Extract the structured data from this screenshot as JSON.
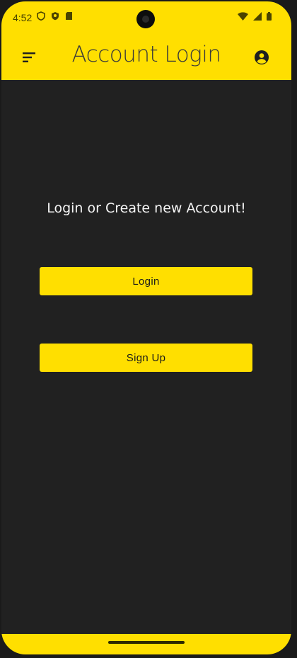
{
  "status_bar": {
    "time": "4:52",
    "left_icons": [
      "shield-outline-icon",
      "shield-filled-icon",
      "sim-card-icon"
    ],
    "right_icons": [
      "wifi-icon",
      "cell-signal-icon",
      "battery-icon"
    ]
  },
  "app_bar": {
    "title": "Account Login",
    "menu_icon": "sort-menu-icon",
    "account_icon": "account-circle-icon"
  },
  "main": {
    "prompt": "Login or Create new Account!",
    "login_button": "Login",
    "signup_button": "Sign Up"
  },
  "colors": {
    "accent": "#ffdf00",
    "background": "#212121",
    "text_on_dark": "#f5f5f5",
    "text_on_accent": "#1a1a1a"
  }
}
